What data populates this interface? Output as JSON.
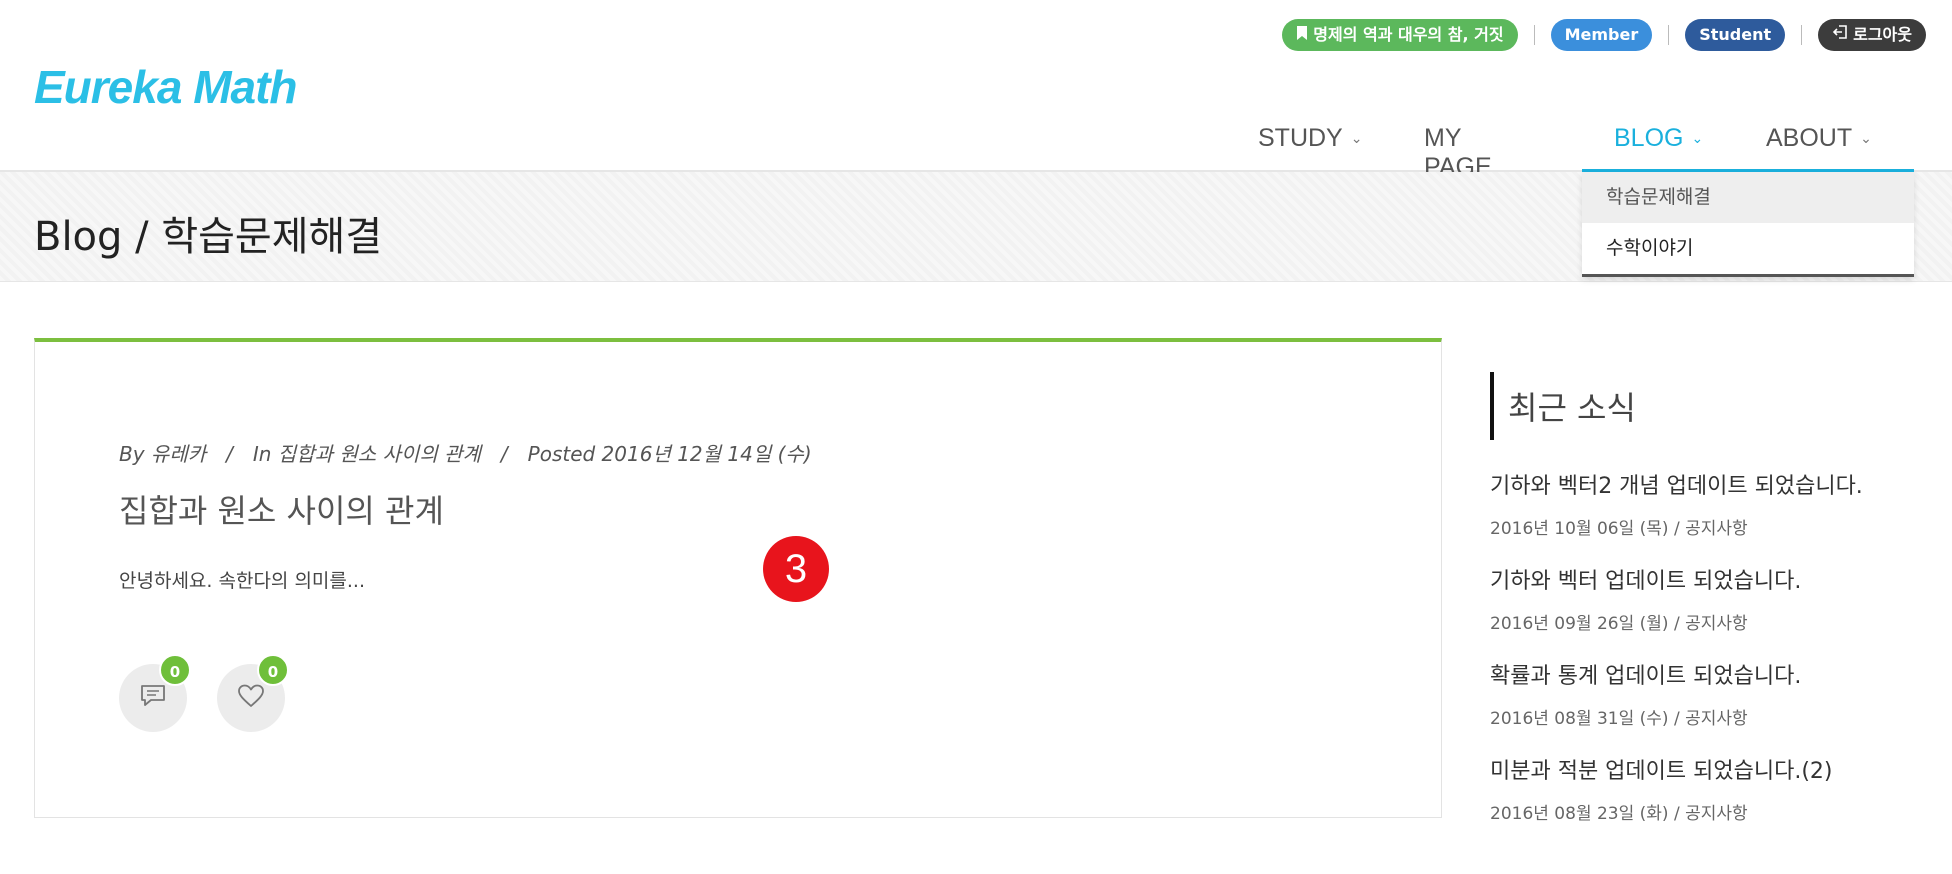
{
  "header": {
    "logo": "Eureka Math",
    "topbar": {
      "current_topic": "명제의 역과 대우의 참, 거짓",
      "current_topic_icon": "bookmark-icon",
      "member_label": "Member",
      "student_label": "Student",
      "logout_label": "로그아웃",
      "logout_icon": "logout-icon"
    },
    "nav": [
      {
        "label": "STUDY",
        "has_dropdown": true
      },
      {
        "label": "MY PAGE",
        "has_dropdown": false
      },
      {
        "label": "BLOG",
        "has_dropdown": true,
        "active": true
      },
      {
        "label": "ABOUT",
        "has_dropdown": true
      }
    ],
    "blog_dropdown": [
      "학습문제해결",
      "수학이야기"
    ]
  },
  "titlebar": {
    "title": "Blog / 학습문제해결"
  },
  "post": {
    "meta_author": "By 유레카",
    "meta_category": "In 집합과 원소 사이의 관계",
    "meta_posted": "Posted 2016년 12월 14일 (수)",
    "title": "집합과 원소 사이의 관계",
    "excerpt": "안녕하세요. 속한다의 의미를...",
    "step_badge": "3",
    "comment_count": "0",
    "like_count": "0"
  },
  "sidebar": {
    "heading": "최근 소식",
    "news": [
      {
        "title": "기하와 벡터2 개념 업데이트 되었습니다.",
        "meta": "2016년 10월 06일 (목) / 공지사항"
      },
      {
        "title": "기하와 벡터 업데이트 되었습니다.",
        "meta": "2016년 09월 26일 (월) / 공지사항"
      },
      {
        "title": "확률과 통계 업데이트 되었습니다.",
        "meta": "2016년 08월 31일 (수) / 공지사항"
      },
      {
        "title": "미분과 적분 업데이트 되었습니다.(2)",
        "meta": "2016년 08월 23일 (화) / 공지사항"
      }
    ]
  },
  "colors": {
    "brand": "#2bbfe6",
    "accent_active": "#1ab0dd",
    "card_top_border": "#7cbf3f",
    "count_badge": "#6fbf3a",
    "step_badge": "#e8141c"
  }
}
